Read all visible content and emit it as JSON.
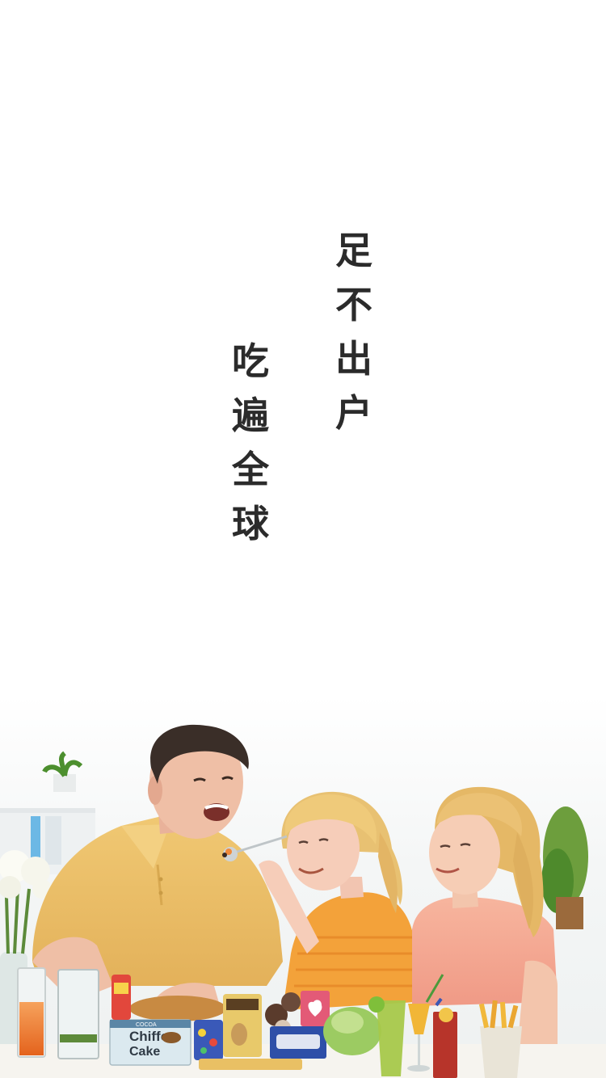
{
  "slogan": {
    "right_column": [
      "足",
      "不",
      "出",
      "户"
    ],
    "left_column": [
      "吃",
      "遍",
      "全",
      "球"
    ]
  },
  "illustration": {
    "packages": {
      "chiffon_line1": "Chiffon",
      "chiffon_line2": "Cake",
      "cocoa": "COCOA"
    }
  },
  "colors": {
    "background": "#ffffff",
    "text": "#2b2b2b"
  }
}
